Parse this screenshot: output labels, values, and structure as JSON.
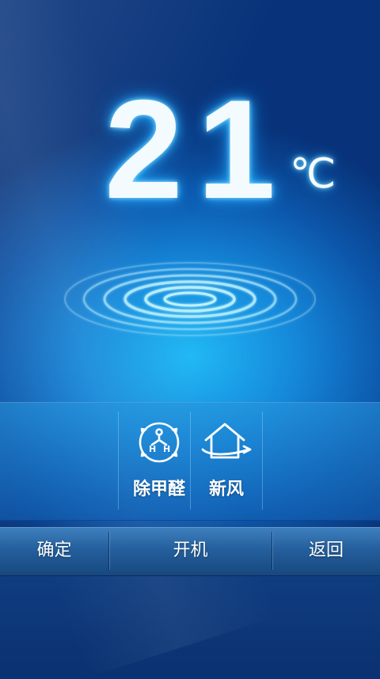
{
  "display": {
    "temperature": "21",
    "unit": "℃"
  },
  "functions": [
    {
      "label": "除甲醛",
      "icon": "formaldehyde-molecule-icon"
    },
    {
      "label": "新风",
      "icon": "fresh-air-house-icon"
    }
  ],
  "bottom_bar": {
    "confirm_label": "确定",
    "power_label": "开机",
    "back_label": "返回"
  },
  "colors": {
    "background_center": "#21b9f5",
    "background_edge": "#08337a",
    "text": "#ffffff"
  }
}
